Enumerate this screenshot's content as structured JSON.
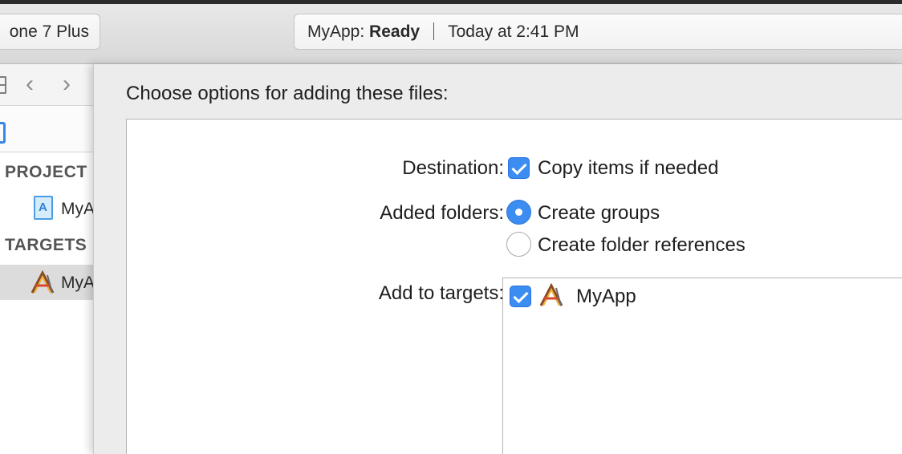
{
  "toolbar": {
    "scheme_device": "one 7 Plus",
    "status": {
      "app_name": "MyApp:",
      "state": "Ready",
      "timestamp": "Today at 2:41 PM"
    }
  },
  "navigator": {
    "sections": {
      "project": "PROJECT",
      "targets": "TARGETS"
    },
    "project_item": "MyA",
    "target_item": "MyA"
  },
  "dialog": {
    "heading": "Choose options for adding these files:",
    "destination": {
      "label": "Destination:",
      "option": "Copy items if needed",
      "checked": true
    },
    "added_folders": {
      "label": "Added folders:",
      "options": [
        "Create groups",
        "Create folder references"
      ],
      "selected": "Create groups"
    },
    "add_to_targets": {
      "label": "Add to targets:",
      "items": [
        {
          "name": "MyApp",
          "checked": true
        }
      ]
    }
  },
  "colors": {
    "accent": "#3b8df2",
    "window_bg": "#ececec",
    "panel_bg": "#ffffff"
  },
  "icons": [
    "hierarchy-icon",
    "chevron-left-icon",
    "chevron-right-icon",
    "project-file-icon",
    "app-target-icon",
    "checkmark-icon"
  ]
}
